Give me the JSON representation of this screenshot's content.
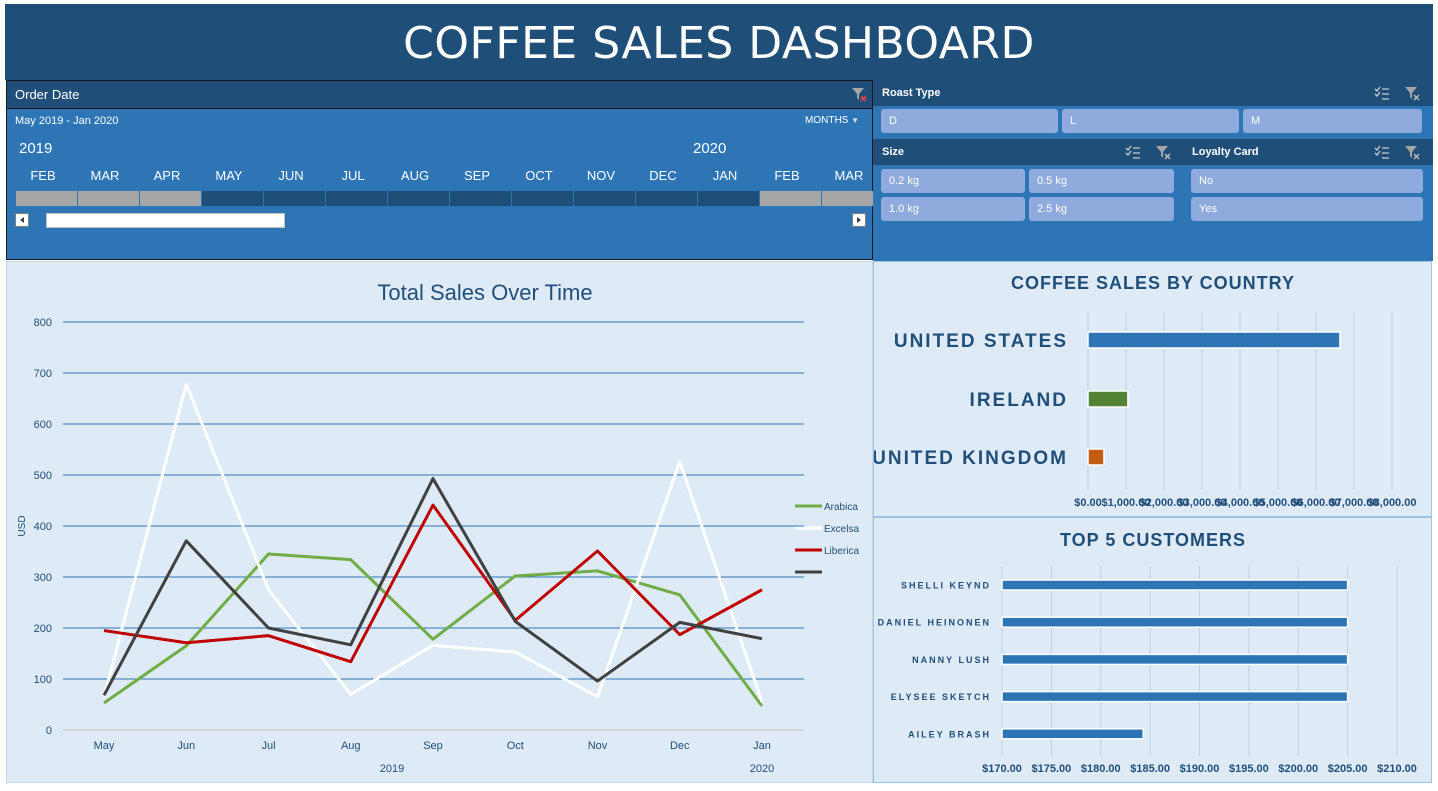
{
  "title": "COFFEE SALES DASHBOARD",
  "timeline": {
    "header": "Order Date",
    "range": "May 2019 - Jan 2020",
    "level": "MONTHS",
    "years": [
      "2019",
      "2020"
    ],
    "months": [
      "FEB",
      "MAR",
      "APR",
      "MAY",
      "JUN",
      "JUL",
      "AUG",
      "SEP",
      "OCT",
      "NOV",
      "DEC",
      "JAN",
      "FEB",
      "MAR"
    ],
    "selected": [
      false,
      false,
      false,
      true,
      true,
      true,
      true,
      true,
      true,
      true,
      true,
      true,
      false,
      false
    ]
  },
  "slicers": {
    "roast": {
      "title": "Roast Type",
      "items": [
        "D",
        "L",
        "M"
      ]
    },
    "size": {
      "title": "Size",
      "items": [
        "0.2 kg",
        "0.5 kg",
        "1.0 kg",
        "2.5 kg"
      ]
    },
    "loyalty": {
      "title": "Loyalty Card",
      "items": [
        "No",
        "Yes"
      ]
    }
  },
  "colors": {
    "arabica": "#70ad47",
    "excelsa": "#ffffff",
    "liberica": "#c00000",
    "robusta": "#404040",
    "us": "#2e75b6",
    "ireland": "#548235",
    "uk": "#c55a11",
    "customer": "#2e75b6"
  },
  "chart_data": [
    {
      "type": "line",
      "title": "Total Sales Over Time",
      "ylabel": "USD",
      "categories": [
        "May",
        "Jun",
        "Jul",
        "Aug",
        "Sep",
        "Oct",
        "Nov",
        "Dec",
        "Jan"
      ],
      "year_labels": [
        "2019",
        "2020"
      ],
      "ylim": [
        0,
        800
      ],
      "yticks": [
        "0",
        "100",
        "200",
        "300",
        "400",
        "500",
        "600",
        "700",
        "800"
      ],
      "series": [
        {
          "name": "Arabica",
          "values": [
            53,
            165,
            345,
            334,
            178,
            302,
            312,
            265,
            47
          ]
        },
        {
          "name": "Excelsa",
          "values": [
            65,
            678,
            275,
            70,
            166,
            153,
            65,
            526,
            55
          ]
        },
        {
          "name": "Liberica",
          "values": [
            195,
            171,
            185,
            134,
            441,
            215,
            351,
            187,
            275
          ]
        },
        {
          "name": "",
          "values": [
            68,
            371,
            200,
            167,
            493,
            213,
            96,
            211,
            179
          ]
        }
      ],
      "grid": true,
      "legend": "right"
    },
    {
      "type": "bar",
      "title": "COFFEE SALES BY COUNTRY",
      "categories": [
        "UNITED STATES",
        "IRELAND",
        "UNITED KINGDOM"
      ],
      "values": [
        6630,
        1050,
        420
      ],
      "xlim": [
        0,
        8000
      ],
      "xticks": [
        "$0.00",
        "$1,000.00",
        "$2,000.00",
        "$3,000.00",
        "$4,000.00",
        "$5,000.00",
        "$6,000.00",
        "$7,000.00",
        "$8,000.00"
      ]
    },
    {
      "type": "bar",
      "title": "TOP 5 CUSTOMERS",
      "categories": [
        "SHELLI KEYND",
        "DANIEL HEINONEN",
        "NANNY LUSH",
        "ELYSEE SKETCH",
        "AILEY BRASH"
      ],
      "values": [
        205.0,
        205.0,
        205.0,
        205.0,
        184.3
      ],
      "xlim": [
        170,
        210
      ],
      "xticks": [
        "$170.00",
        "$175.00",
        "$180.00",
        "$185.00",
        "$190.00",
        "$195.00",
        "$200.00",
        "$205.00",
        "$210.00"
      ]
    }
  ]
}
